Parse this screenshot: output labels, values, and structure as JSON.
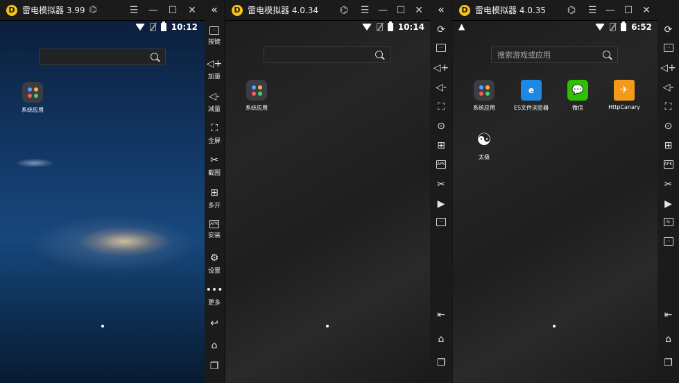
{
  "windows": [
    {
      "title": "雷电模拟器 3.99",
      "time": "10:12",
      "app_label": "系统应用"
    },
    {
      "title": "雷电模拟器 4.0.34",
      "time": "10:14",
      "app_label": "系统应用"
    },
    {
      "title": "雷电模拟器 4.0.35",
      "time": "6:52",
      "search_placeholder": "搜索游戏或应用",
      "apps": [
        "系统应用",
        "ES文件浏览器",
        "微信",
        "HttpCanary",
        "太极"
      ]
    }
  ],
  "sidebar1": {
    "collapse": "«",
    "items": [
      {
        "icon": "keyboard-icon",
        "label": "按键"
      },
      {
        "icon": "volume-up-icon",
        "label": "加量"
      },
      {
        "icon": "volume-down-icon",
        "label": "减量"
      },
      {
        "icon": "fullscreen-icon",
        "label": "全屏"
      },
      {
        "icon": "scissors-icon",
        "label": "截图"
      },
      {
        "icon": "multi-open-icon",
        "label": "多开"
      },
      {
        "icon": "apk-install-icon",
        "label": "安装"
      },
      {
        "icon": "gear-icon",
        "label": "设置"
      },
      {
        "icon": "more-icon",
        "label": "更多"
      }
    ],
    "nav": [
      "back-icon",
      "home-icon",
      "recents-icon"
    ]
  },
  "colors": {
    "titlebar": "#1b1b1b",
    "logo": "#f6c21b",
    "sidebar": "#1b1b1b",
    "es_icon": "#1e88e5",
    "wechat_icon": "#2dc100",
    "httpcanary_icon": "#f29a1a"
  }
}
